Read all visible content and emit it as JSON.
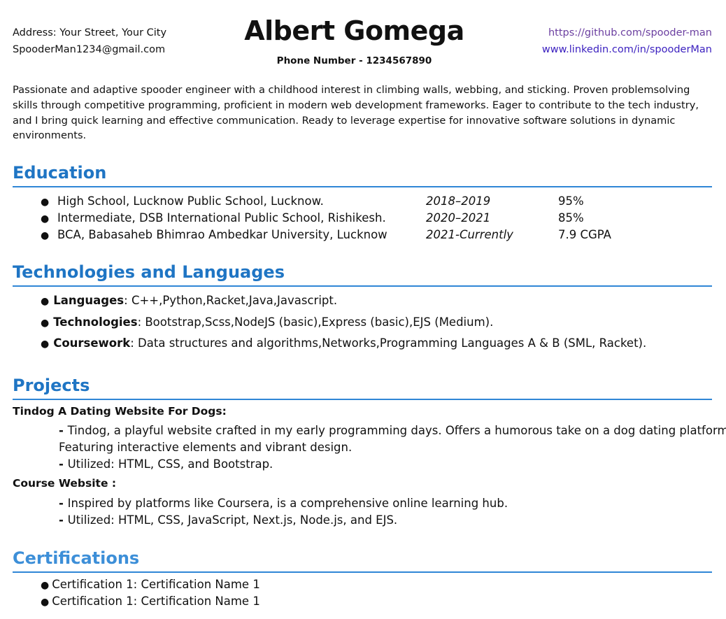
{
  "header": {
    "address": "Address: Your Street, Your City",
    "email": "SpooderMan1234@gmail.com",
    "name": "Albert Gomega",
    "phone": "Phone Number - 1234567890",
    "github": "https://github.com/spooder-man",
    "linkedin": "www.linkedin.com/in/spooderMan"
  },
  "summary": "Passionate and adaptive spooder engineer with a childhood interest in climbing walls, webbing, and sticking. Proven problemsolving skills through competitive programming, proficient in modern web development frameworks. Eager to contribute to the tech industry, and I bring quick learning and effective communication. Ready to leverage expertise for innovative software solutions in dynamic environments.",
  "education": {
    "title": "Education",
    "rows": [
      {
        "school": "High School, Lucknow Public School, Lucknow.",
        "years": "2018–2019",
        "score": "95%"
      },
      {
        "school": "Intermediate, DSB International Public School, Rishikesh.",
        "years": "2020–2021",
        "score": "85%"
      },
      {
        "school": "BCA, Babasaheb Bhimrao Ambedkar University, Lucknow",
        "years": "2021-Currently",
        "score": "7.9 CGPA"
      }
    ]
  },
  "technologies": {
    "title": "Technologies and Languages",
    "rows": [
      {
        "label": "Languages",
        "text": ": C++,Python,Racket,Java,Javascript."
      },
      {
        "label": "Technologies",
        "text": ": Bootstrap,Scss,NodeJS (basic),Express (basic),EJS (Medium)."
      },
      {
        "label": "Coursework",
        "text": ": Data structures and algorithms,Networks,Programming Languages A & B (SML, Racket)."
      }
    ]
  },
  "projects": {
    "title": "Projects",
    "items": [
      {
        "name": "Tindog A Dating Website For Dogs:",
        "lines": [
          "Tindog, a playful website crafted in my early programming days. Offers a humorous take on a dog dating platform.",
          "Featuring interactive elements and vibrant design.",
          "Utilized: HTML, CSS, and Bootstrap."
        ]
      },
      {
        "name": "Course Website :",
        "lines": [
          "Inspired by platforms like Coursera, is a comprehensive online learning hub.",
          "Utilized: HTML, CSS, JavaScript, Next.js, Node.js, and EJS."
        ]
      }
    ]
  },
  "certifications": {
    "title": "Certifications",
    "items": [
      "Certification 1: Certification Name 1",
      "Certification 1: Certification Name 1"
    ]
  },
  "colors": {
    "section_title": "#1f75c4",
    "rule": "#2f86d6",
    "linkedin": "#3a1fbf",
    "github": "#6b3fa0"
  }
}
